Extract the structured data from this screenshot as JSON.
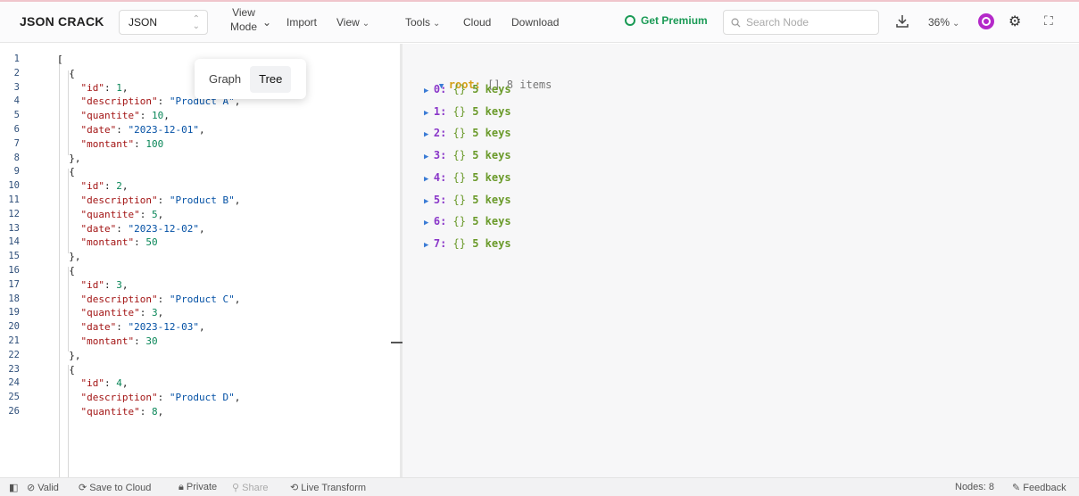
{
  "toolbar": {
    "brand": "JSON CRACK",
    "format": "JSON",
    "view_mode_line1": "View",
    "view_mode_line2": "Mode",
    "import": "Import",
    "view": "View",
    "tools": "Tools",
    "cloud": "Cloud",
    "download": "Download",
    "premium": "Get Premium",
    "search_placeholder": "Search Node",
    "zoom": "36%"
  },
  "view_mode_popover": {
    "options": [
      "Graph",
      "Tree"
    ],
    "selected": "Tree"
  },
  "editor": {
    "line_numbers": [
      "1",
      "2",
      "3",
      "4",
      "5",
      "6",
      "7",
      "8",
      "9",
      "10",
      "11",
      "12",
      "13",
      "14",
      "15",
      "16",
      "17",
      "18",
      "19",
      "20",
      "21",
      "22",
      "23",
      "24",
      "25",
      "26"
    ],
    "records": [
      {
        "id": 1,
        "description": "Product A",
        "quantite": 10,
        "date": "2023-12-01",
        "montant": 100
      },
      {
        "id": 2,
        "description": "Product B",
        "quantite": 5,
        "date": "2023-12-02",
        "montant": 50
      },
      {
        "id": 3,
        "description": "Product C",
        "quantite": 3,
        "date": "2023-12-03",
        "montant": 30
      },
      {
        "id": 4,
        "description": "Product D",
        "quantite": 8
      }
    ]
  },
  "tree": {
    "root_label": "root:",
    "root_bracket": "[]",
    "root_meta": "8 items",
    "children": [
      {
        "key": "0:",
        "bracket": "{}",
        "meta": "5 keys"
      },
      {
        "key": "1:",
        "bracket": "{}",
        "meta": "5 keys"
      },
      {
        "key": "2:",
        "bracket": "{}",
        "meta": "5 keys"
      },
      {
        "key": "3:",
        "bracket": "{}",
        "meta": "5 keys"
      },
      {
        "key": "4:",
        "bracket": "{}",
        "meta": "5 keys"
      },
      {
        "key": "5:",
        "bracket": "{}",
        "meta": "5 keys"
      },
      {
        "key": "6:",
        "bracket": "{}",
        "meta": "5 keys"
      },
      {
        "key": "7:",
        "bracket": "{}",
        "meta": "5 keys"
      }
    ]
  },
  "statusbar": {
    "valid": "Valid",
    "save": "Save to Cloud",
    "private": "Private",
    "share": "Share",
    "live": "Live Transform",
    "nodes": "Nodes: 8",
    "feedback": "Feedback"
  },
  "colors": {
    "accent_premium": "#1a9a55",
    "avatar": "#b429c9",
    "json_key": "#a31515",
    "json_string": "#0451a5",
    "json_number": "#098658"
  }
}
